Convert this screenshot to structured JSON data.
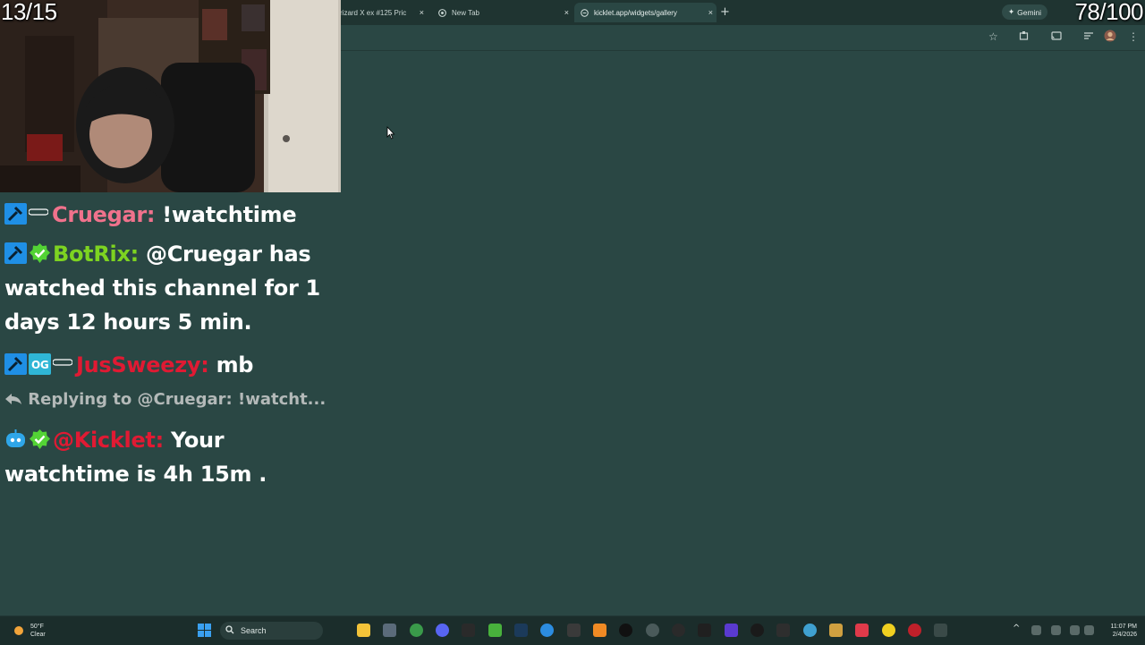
{
  "overlay": {
    "left_counter": "13/15",
    "right_counter": "78/100"
  },
  "browser": {
    "tabs": [
      {
        "title": "rizard X ex #125 Pric",
        "close": "×"
      },
      {
        "title": "New Tab",
        "close": "×"
      },
      {
        "title": "kicklet.app/widgets/gallery",
        "close": "×"
      }
    ],
    "new_tab_glyph": "+",
    "gemini_label": "Gemini",
    "toolbar_icons": [
      "star-icon",
      "extensions-icon",
      "cast-icon",
      "tab-search-icon",
      "profile-icon",
      "menu-icon"
    ]
  },
  "chat": {
    "messages": [
      {
        "user": "Cruegar:",
        "text": " !watchtime",
        "user_color": "#f0728c"
      },
      {
        "user": "BotRix:",
        "text": " @Cruegar has watched this channel for 1 days 12 hours 5 min.",
        "user_color": "#7dd321"
      },
      {
        "user": "JusSweezy:",
        "text": " mb",
        "user_color": "#e01a33"
      },
      {
        "reply": "Replying to @Cruegar: !watcht..."
      },
      {
        "user": "@Kicklet:",
        "text": " Your watchtime is 4h 15m .",
        "user_color": "#e01a33"
      }
    ]
  },
  "taskbar": {
    "weather_temp": "50°F",
    "weather_cond": "Clear",
    "search_label": "Search",
    "time": "11:07 PM",
    "date": "2/4/2026"
  },
  "colors": {
    "page_bg": "#2a4744",
    "tabstrip_bg": "#1f3431",
    "taskbar_bg": "#1b2d2b"
  }
}
